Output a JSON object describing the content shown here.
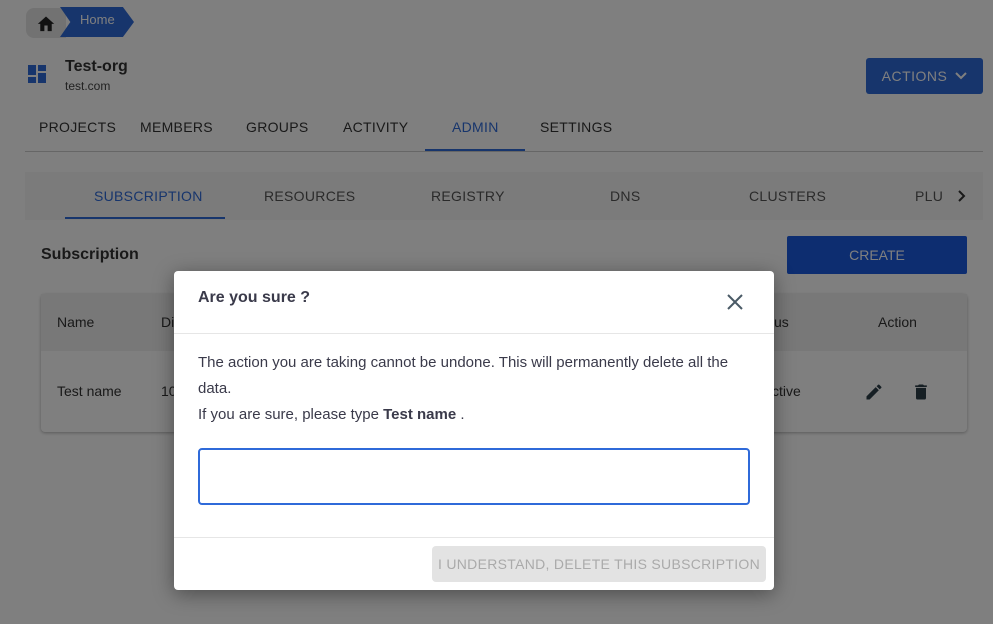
{
  "breadcrumb": {
    "home_icon": "home-icon",
    "current": "Home"
  },
  "org": {
    "icon": "dashboard-icon",
    "name": "Test-org",
    "domain": "test.com"
  },
  "actions_label": "ACTIONS",
  "tabs": [
    {
      "label": "PROJECTS"
    },
    {
      "label": "MEMBERS"
    },
    {
      "label": "GROUPS"
    },
    {
      "label": "ACTIVITY"
    },
    {
      "label": "ADMIN",
      "active": true
    },
    {
      "label": "SETTINGS"
    }
  ],
  "subtabs": [
    {
      "label": "SUBSCRIPTION",
      "active": true
    },
    {
      "label": "RESOURCES"
    },
    {
      "label": "REGISTRY"
    },
    {
      "label": "DNS"
    },
    {
      "label": "CLUSTERS"
    },
    {
      "label": "PLU"
    }
  ],
  "section_title": "Subscription",
  "create_label": "CREATE",
  "table": {
    "headers": [
      "Name",
      "Di",
      "us",
      "Action"
    ],
    "row": [
      "Test name",
      "10",
      "ctive"
    ]
  },
  "dialog": {
    "title": "Are you sure ?",
    "line1": "The action you are taking cannot be undone. This will permanently delete all the data.",
    "line2_prefix": "If you are sure, please type ",
    "line2_name": "Test name",
    "line2_suffix": " .",
    "input_value": "",
    "button": "I UNDERSTAND, DELETE THIS SUBSCRIPTION"
  },
  "colors": {
    "accent": "#2f6ad9",
    "create": "#1a5ae0"
  }
}
